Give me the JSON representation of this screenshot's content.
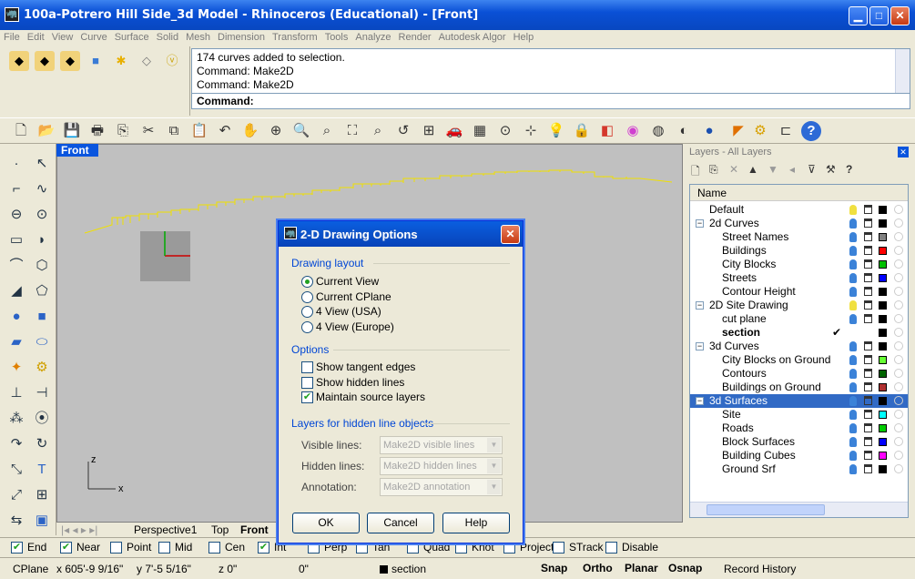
{
  "window": {
    "title": "100a-Potrero Hill Side_3d Model - Rhinoceros (Educational) - [Front]",
    "min": "▁",
    "max": "□",
    "close": "✕"
  },
  "menu": [
    "File",
    "Edit",
    "View",
    "Curve",
    "Surface",
    "Solid",
    "Mesh",
    "Dimension",
    "Transform",
    "Tools",
    "Analyze",
    "Render",
    "Autodesk Algor",
    "Help"
  ],
  "command": {
    "history": [
      "174 curves added to selection.",
      "Command: Make2D",
      "Command: Make2D"
    ],
    "prompt": "Command:"
  },
  "viewport": {
    "title": "Front",
    "tabs": [
      "Perspective1",
      "Top",
      "Front"
    ],
    "axis_x": "x",
    "axis_z": "z"
  },
  "layers": {
    "title": "Layers - All Layers",
    "column_name": "Name",
    "rows": [
      {
        "name": "Default",
        "indent": 0,
        "color": "#000000"
      },
      {
        "name": "2d Curves",
        "indent": 0,
        "color": "#000000",
        "expander": "−"
      },
      {
        "name": "Street Names",
        "indent": 1,
        "color": "#808080"
      },
      {
        "name": "Buildings",
        "indent": 1,
        "color": "#ff0000"
      },
      {
        "name": "City Blocks",
        "indent": 1,
        "color": "#00c000"
      },
      {
        "name": "Streets",
        "indent": 1,
        "color": "#0000ff"
      },
      {
        "name": "Contour Height",
        "indent": 1,
        "color": "#000000"
      },
      {
        "name": "2D Site Drawing",
        "indent": 0,
        "color": "#000000",
        "expander": "−"
      },
      {
        "name": "cut plane",
        "indent": 1,
        "color": "#000000"
      },
      {
        "name": "section",
        "indent": 1,
        "color": "#000000",
        "bold": true,
        "current": "✔"
      },
      {
        "name": "3d Curves",
        "indent": 0,
        "color": "#000000",
        "expander": "−"
      },
      {
        "name": "City Blocks on Ground",
        "indent": 1,
        "color": "#66ff33"
      },
      {
        "name": "Contours",
        "indent": 1,
        "color": "#006400"
      },
      {
        "name": "Buildings on Ground",
        "indent": 1,
        "color": "#b03030"
      },
      {
        "name": "3d Surfaces",
        "indent": 0,
        "color": "#000000",
        "expander": "−",
        "selected": true
      },
      {
        "name": "Site",
        "indent": 1,
        "color": "#00ffff"
      },
      {
        "name": "Roads",
        "indent": 1,
        "color": "#00cc00"
      },
      {
        "name": "Block Surfaces",
        "indent": 1,
        "color": "#0000ff"
      },
      {
        "name": "Building Cubes",
        "indent": 1,
        "color": "#ff00ff"
      },
      {
        "name": "Ground Srf",
        "indent": 1,
        "color": "#000000"
      }
    ]
  },
  "osnap": [
    {
      "label": "End",
      "checked": true
    },
    {
      "label": "Near",
      "checked": true
    },
    {
      "label": "Point",
      "checked": false
    },
    {
      "label": "Mid",
      "checked": false
    },
    {
      "label": "Cen",
      "checked": false
    },
    {
      "label": "Int",
      "checked": true
    },
    {
      "label": "Perp",
      "checked": false
    },
    {
      "label": "Tan",
      "checked": false
    },
    {
      "label": "Quad",
      "checked": false
    },
    {
      "label": "Knot",
      "checked": false
    },
    {
      "label": "Project",
      "checked": false
    },
    {
      "label": "STrack",
      "checked": false
    },
    {
      "label": "Disable",
      "checked": false
    }
  ],
  "status": {
    "cplane": "CPlane",
    "x": "x 605'-9 9/16\"",
    "y": "y 7'-5 5/16\"",
    "z": "z 0\"",
    "dist": "0\"",
    "layer": "section",
    "snap": "Snap",
    "ortho": "Ortho",
    "planar": "Planar",
    "osnap": "Osnap",
    "history": "Record History"
  },
  "dialog": {
    "title": "2-D Drawing Options",
    "close": "✕",
    "layout_label": "Drawing layout",
    "layout_options": [
      {
        "label": "Current View",
        "selected": true
      },
      {
        "label": "Current CPlane",
        "selected": false
      },
      {
        "label": "4 View (USA)",
        "selected": false
      },
      {
        "label": "4 View (Europe)",
        "selected": false
      }
    ],
    "options_label": "Options",
    "options": [
      {
        "label": "Show tangent edges",
        "checked": false
      },
      {
        "label": "Show hidden lines",
        "checked": false
      },
      {
        "label": "Maintain source layers",
        "checked": true
      }
    ],
    "hidden_label": "Layers for hidden line objects",
    "fields": [
      {
        "label": "Visible lines:",
        "value": "Make2D visible lines"
      },
      {
        "label": "Hidden lines:",
        "value": "Make2D hidden lines"
      },
      {
        "label": "Annotation:",
        "value": "Make2D annotation"
      }
    ],
    "ok": "OK",
    "cancel": "Cancel",
    "help": "Help"
  }
}
